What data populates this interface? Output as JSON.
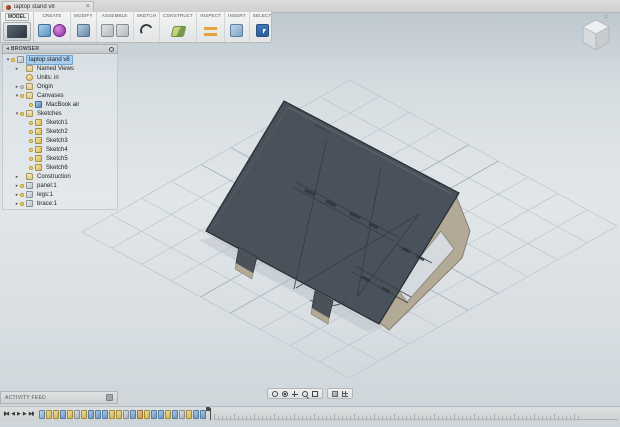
{
  "app": {
    "tab_title": "laptop stand v8",
    "close_label": "×",
    "home_glyph": "⌂"
  },
  "colors": {
    "selection_highlight": "#a9cdec",
    "model_panel": "#49525a",
    "model_frame_tan": "#b2a996",
    "canvas_top": "#bdc7ce",
    "canvas_mid": "#e1e6e9"
  },
  "toolbar": {
    "workspace_label": "MODEL",
    "groups": [
      {
        "label": "CREATE",
        "icons": [
          "create-primitive-icon",
          "create-sphere-icon"
        ]
      },
      {
        "label": "MODIFY",
        "icons": [
          "press-pull-icon"
        ]
      },
      {
        "label": "ASSEMBLE",
        "icons": [
          "new-component-icon",
          "joint-icon"
        ]
      },
      {
        "label": "SKETCH",
        "icons": [
          "create-sketch-icon"
        ]
      },
      {
        "label": "CONSTRUCT",
        "icons": [
          "construct-plane-icon"
        ]
      },
      {
        "label": "INSPECT",
        "icons": [
          "measure-icon"
        ]
      },
      {
        "label": "INSERT",
        "icons": [
          "insert-mesh-icon"
        ]
      },
      {
        "label": "SELECT",
        "icons": [
          "select-icon"
        ]
      }
    ]
  },
  "browser": {
    "title": "BROWSER",
    "collapse_glyph": "◂",
    "items": [
      {
        "label": "laptop stand v8",
        "indent": 0,
        "arrow": "down",
        "bulb": "on",
        "icon": "component",
        "selected": true
      },
      {
        "label": "Named Views",
        "indent": 1,
        "arrow": "right",
        "bulb": null,
        "icon": "folder"
      },
      {
        "label": "Units: in",
        "indent": 1,
        "arrow": null,
        "bulb": null,
        "icon": "units"
      },
      {
        "label": "Origin",
        "indent": 1,
        "arrow": "right",
        "bulb": "off",
        "icon": "folder"
      },
      {
        "label": "Canvases",
        "indent": 1,
        "arrow": "down",
        "bulb": "on",
        "icon": "folder"
      },
      {
        "label": "MacBook air",
        "indent": 2,
        "arrow": null,
        "bulb": "on",
        "icon": "canvas"
      },
      {
        "label": "Sketches",
        "indent": 1,
        "arrow": "down",
        "bulb": "on",
        "icon": "folder"
      },
      {
        "label": "Sketch1",
        "indent": 2,
        "arrow": null,
        "bulb": "on",
        "icon": "sketch"
      },
      {
        "label": "Sketch2",
        "indent": 2,
        "arrow": null,
        "bulb": "on",
        "icon": "sketch"
      },
      {
        "label": "Sketch3",
        "indent": 2,
        "arrow": null,
        "bulb": "on",
        "icon": "sketch"
      },
      {
        "label": "Sketch4",
        "indent": 2,
        "arrow": null,
        "bulb": "on",
        "icon": "sketch"
      },
      {
        "label": "Sketch5",
        "indent": 2,
        "arrow": null,
        "bulb": "on",
        "icon": "sketch"
      },
      {
        "label": "Sketch6",
        "indent": 2,
        "arrow": null,
        "bulb": "on",
        "icon": "sketch"
      },
      {
        "label": "Construction",
        "indent": 1,
        "arrow": "right",
        "bulb": null,
        "icon": "folder"
      },
      {
        "label": "panel:1",
        "indent": 1,
        "arrow": "right",
        "bulb": "on",
        "icon": "component"
      },
      {
        "label": "legs:1",
        "indent": 1,
        "arrow": "right",
        "bulb": "on",
        "icon": "component"
      },
      {
        "label": "brace:1",
        "indent": 1,
        "arrow": "right",
        "bulb": "on",
        "icon": "component"
      }
    ]
  },
  "activity_feed": {
    "label": "ACTIVITY FEED"
  },
  "navbar": {
    "groups": [
      {
        "icons": [
          "orbit-icon",
          "look-at-icon",
          "pan-icon",
          "zoom-icon",
          "fit-icon"
        ]
      },
      {
        "icons": [
          "display-settings-icon",
          "grid-display-icon"
        ]
      }
    ]
  },
  "timeline": {
    "playback": [
      {
        "name": "go-to-start",
        "glyph": "▮◀"
      },
      {
        "name": "step-back",
        "glyph": "◀"
      },
      {
        "name": "play",
        "glyph": "▶"
      },
      {
        "name": "step-forward",
        "glyph": "▶"
      },
      {
        "name": "go-to-end",
        "glyph": "▶▮"
      }
    ],
    "features": [
      "canvas",
      "sketch",
      "sketch",
      "extrude",
      "sketch",
      "construct",
      "sketch",
      "extrude",
      "extrude",
      "extrude",
      "sketch",
      "sketch",
      "construct",
      "extrude",
      "modify",
      "sketch",
      "extrude",
      "extrude",
      "sketch",
      "extrude",
      "construct",
      "sketch",
      "extrude",
      "extrude"
    ]
  }
}
